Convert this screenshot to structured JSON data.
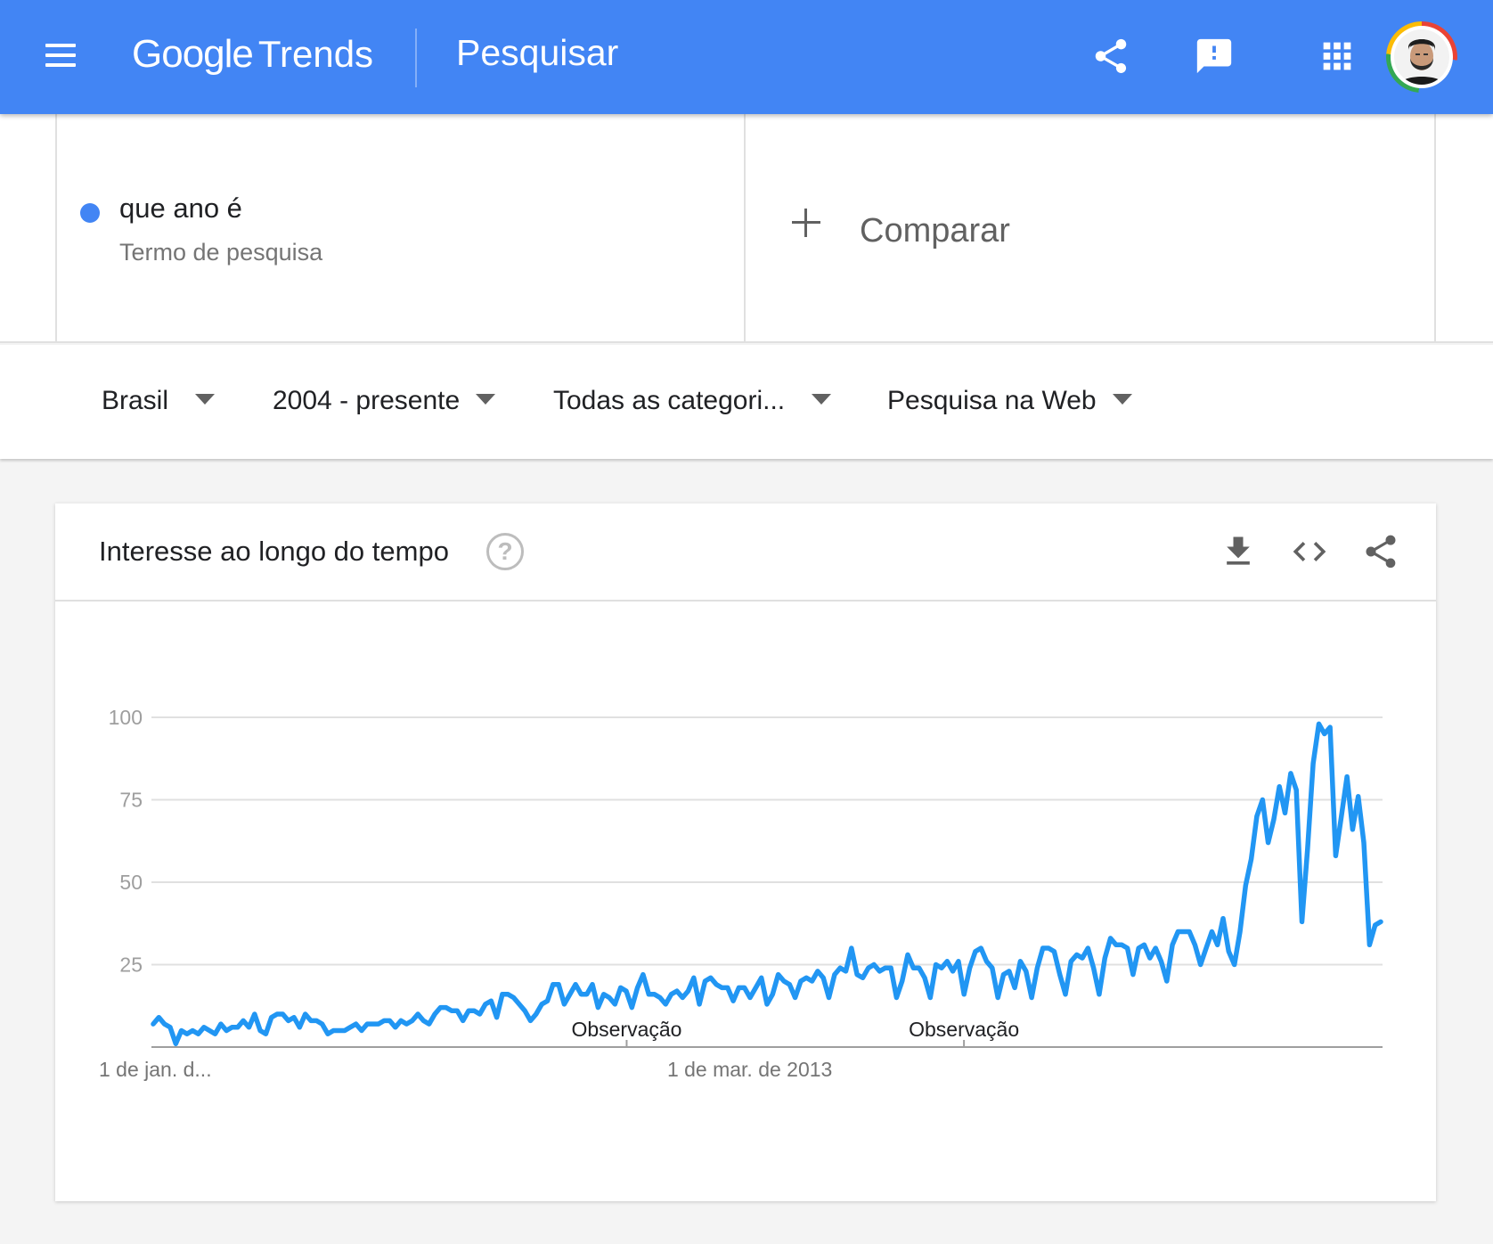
{
  "header": {
    "brand_google": "Google",
    "brand_trends": "Trends",
    "page_title": "Pesquisar",
    "icons": [
      "menu-icon",
      "share-icon",
      "feedback-icon",
      "apps-icon",
      "account-avatar"
    ],
    "accent_color": "#4285f4"
  },
  "term": {
    "name": "que ano é",
    "type": "Termo de pesquisa",
    "color": "#4285f4"
  },
  "compare": {
    "label": "Comparar"
  },
  "filters": {
    "region": "Brasil",
    "time": "2004 - presente",
    "category": "Todas as categori...",
    "property": "Pesquisa na Web"
  },
  "card": {
    "title": "Interesse ao longo do tempo",
    "help_symbol": "?",
    "icons": [
      "download-icon",
      "embed-icon",
      "share-icon"
    ]
  },
  "chart_data": {
    "type": "line",
    "title": "",
    "xlabel": "",
    "ylabel": "",
    "ylim": [
      0,
      100
    ],
    "yticks": [
      25,
      50,
      75,
      100
    ],
    "ytick_labels": [
      "25",
      "50",
      "75",
      "100"
    ],
    "xtick_labels": [
      "1 de jan. d...",
      "1 de mar. de 2013"
    ],
    "annotations": [
      {
        "label": "Observação",
        "x_fraction": 0.386
      },
      {
        "label": "Observação",
        "x_fraction": 0.66
      }
    ],
    "grid": true,
    "line_color": "#2196f3",
    "series": [
      {
        "values": [
          7,
          9,
          7,
          6,
          1,
          5,
          4,
          5,
          4,
          6,
          5,
          4,
          7,
          5,
          6,
          6,
          8,
          6,
          10,
          5,
          4,
          9,
          10,
          10,
          8,
          9,
          6,
          10,
          8,
          8,
          7,
          4,
          5,
          5,
          5,
          6,
          7,
          5,
          7,
          7,
          7,
          8,
          8,
          6,
          8,
          7,
          8,
          10,
          8,
          7,
          10,
          12,
          12,
          11,
          11,
          8,
          11,
          11,
          10,
          13,
          14,
          9,
          16,
          16,
          15,
          13,
          11,
          8,
          10,
          13,
          14,
          19,
          19,
          13,
          16,
          19,
          16,
          16,
          19,
          12,
          16,
          15,
          13,
          18,
          17,
          12,
          18,
          22,
          16,
          16,
          15,
          13,
          16,
          17,
          15,
          17,
          21,
          13,
          20,
          21,
          19,
          18,
          18,
          14,
          18,
          18,
          15,
          18,
          21,
          13,
          16,
          22,
          20,
          19,
          15,
          20,
          21,
          20,
          23,
          21,
          15,
          22,
          24,
          23,
          30,
          22,
          21,
          24,
          25,
          23,
          24,
          24,
          15,
          20,
          28,
          24,
          24,
          21,
          15,
          25,
          24,
          26,
          23,
          26,
          16,
          24,
          29,
          30,
          26,
          24,
          15,
          22,
          23,
          18,
          26,
          23,
          15,
          24,
          30,
          30,
          29,
          22,
          16,
          26,
          28,
          27,
          30,
          24,
          16,
          27,
          33,
          31,
          31,
          30,
          22,
          30,
          31,
          27,
          30,
          26,
          20,
          31,
          35,
          35,
          35,
          31,
          25,
          30,
          35,
          31,
          39,
          29,
          25,
          35,
          49,
          57,
          70,
          75,
          62,
          69,
          79,
          71,
          83,
          78,
          38,
          60,
          86,
          98,
          95,
          97,
          58,
          70,
          82,
          66,
          76,
          62,
          31,
          37,
          38
        ]
      }
    ]
  }
}
